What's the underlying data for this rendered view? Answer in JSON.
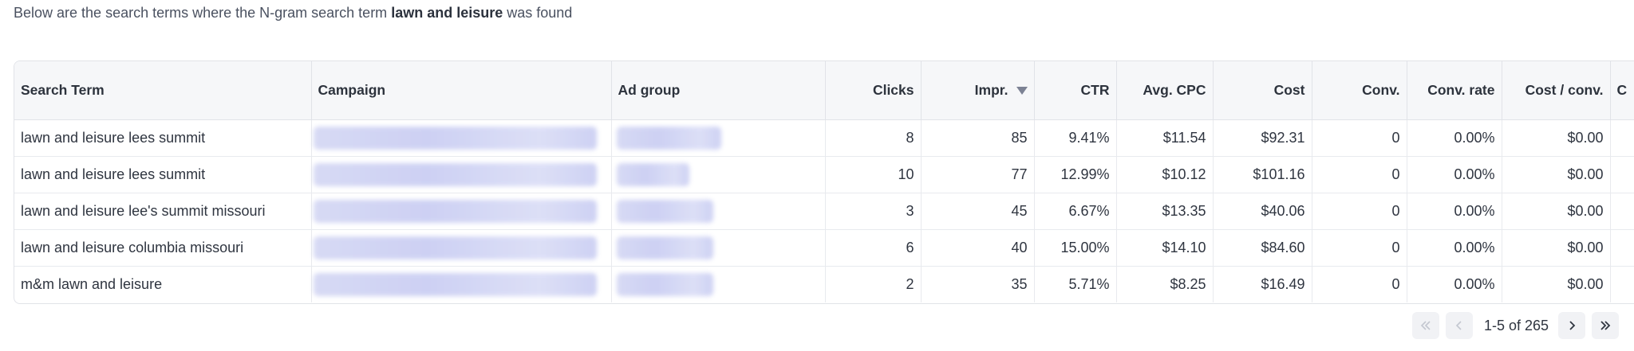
{
  "intro": {
    "prefix": "Below are the search terms where the N-gram search term ",
    "term": "lawn and leisure",
    "suffix": " was found"
  },
  "columns": {
    "search_term": "Search Term",
    "campaign": "Campaign",
    "ad_group": "Ad group",
    "clicks": "Clicks",
    "impr": "Impr.",
    "ctr": "CTR",
    "avg_cpc": "Avg. CPC",
    "cost": "Cost",
    "conv": "Conv.",
    "conv_rate": "Conv. rate",
    "cost_per_conv": "Cost / conv.",
    "extra": "C"
  },
  "sort": {
    "column": "Impr.",
    "direction": "descending",
    "icon": "sort-desc-icon"
  },
  "rows": [
    {
      "search_term": "lawn and leisure lees summit",
      "clicks": "8",
      "impr": "85",
      "ctr": "9.41%",
      "avg_cpc": "$11.54",
      "cost": "$92.31",
      "conv": "0",
      "conv_rate": "0.00%",
      "cost_per_conv": "$0.00"
    },
    {
      "search_term": "lawn and leisure lees summit",
      "clicks": "10",
      "impr": "77",
      "ctr": "12.99%",
      "avg_cpc": "$10.12",
      "cost": "$101.16",
      "conv": "0",
      "conv_rate": "0.00%",
      "cost_per_conv": "$0.00"
    },
    {
      "search_term": "lawn and leisure lee's summit missouri",
      "clicks": "3",
      "impr": "45",
      "ctr": "6.67%",
      "avg_cpc": "$13.35",
      "cost": "$40.06",
      "conv": "0",
      "conv_rate": "0.00%",
      "cost_per_conv": "$0.00"
    },
    {
      "search_term": "lawn and leisure columbia missouri",
      "clicks": "6",
      "impr": "40",
      "ctr": "15.00%",
      "avg_cpc": "$14.10",
      "cost": "$84.60",
      "conv": "0",
      "conv_rate": "0.00%",
      "cost_per_conv": "$0.00"
    },
    {
      "search_term": "m&m lawn and leisure",
      "clicks": "2",
      "impr": "35",
      "ctr": "5.71%",
      "avg_cpc": "$8.25",
      "cost": "$16.49",
      "conv": "0",
      "conv_rate": "0.00%",
      "cost_per_conv": "$0.00"
    }
  ],
  "pagination": {
    "info": "1-5 of 265",
    "first_icon": "double-chevron-left-icon",
    "prev_icon": "chevron-left-icon",
    "next_icon": "chevron-right-icon",
    "last_icon": "double-chevron-right-icon"
  }
}
